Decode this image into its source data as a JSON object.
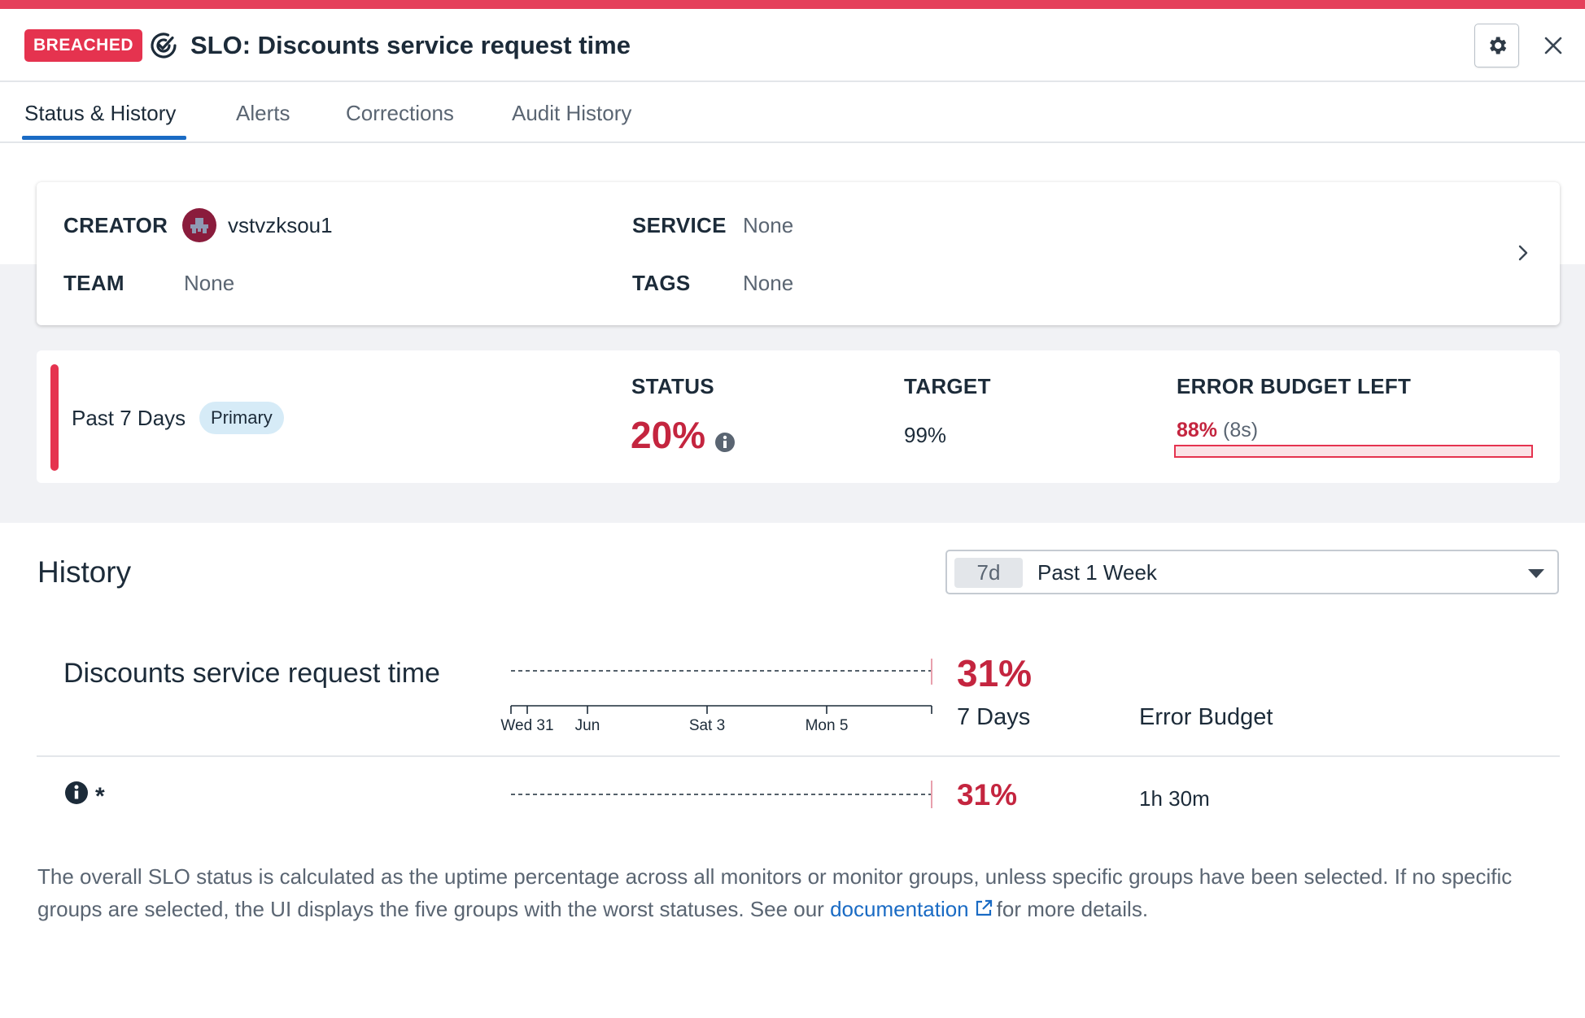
{
  "header": {
    "badge": "BREACHED",
    "title": "SLO: Discounts service request time"
  },
  "tabs": [
    {
      "label": "Status & History",
      "active": true
    },
    {
      "label": "Alerts",
      "active": false
    },
    {
      "label": "Corrections",
      "active": false
    },
    {
      "label": "Audit History",
      "active": false
    }
  ],
  "info": {
    "creator_label": "CREATOR",
    "creator_value": "vstvzksou1",
    "team_label": "TEAM",
    "team_value": "None",
    "service_label": "SERVICE",
    "service_value": "None",
    "tags_label": "TAGS",
    "tags_value": "None"
  },
  "status_card": {
    "window": "Past 7 Days",
    "pill": "Primary",
    "status_label": "STATUS",
    "status_value": "20%",
    "target_label": "TARGET",
    "target_value": "99%",
    "budget_label": "ERROR BUDGET LEFT",
    "budget_pct": "88%",
    "budget_time": "(8s)"
  },
  "history": {
    "title": "History",
    "range_chip": "7d",
    "range_label": "Past 1 Week",
    "row1": {
      "name": "Discounts service request time",
      "pct": "31%",
      "days": "7 Days",
      "budget_header": "Error Budget"
    },
    "axis_ticks": [
      "Wed 31",
      "Jun",
      "Sat 3",
      "Mon 5"
    ],
    "row2": {
      "name": "*",
      "pct": "31%",
      "budget": "1h 30m"
    }
  },
  "footnote": {
    "text_before": "The overall SLO status is calculated as the uptime percentage across all monitors or monitor groups, unless specific groups have been selected. If no specific groups are selected, the UI displays the five groups with the worst statuses. See our",
    "link": "documentation",
    "text_after": "for more details."
  },
  "colors": {
    "breach_red": "#e5334f",
    "value_red": "#c4253f",
    "link_blue": "#1a6bc4"
  }
}
